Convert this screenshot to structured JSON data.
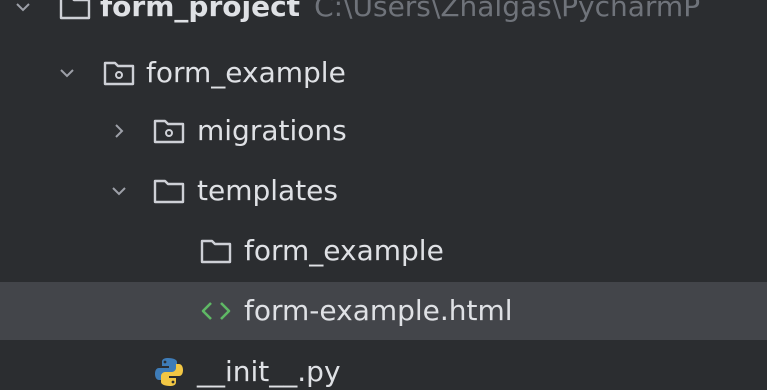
{
  "project_tree": {
    "root": {
      "name": "form_project",
      "path": "C:\\Users\\Zhalgas\\PycharmP"
    },
    "items": [
      {
        "label": "form_example"
      },
      {
        "label": "migrations"
      },
      {
        "label": "templates"
      },
      {
        "label": "form_example"
      },
      {
        "label": "form-example.html"
      },
      {
        "label": "__init__.py"
      }
    ]
  },
  "colors": {
    "background": "#2b2d30",
    "selection": "#43454a",
    "text": "#dfe1e5",
    "muted": "#6f737a",
    "html_icon": "#5fb865",
    "python_blue": "#3e7cb8",
    "python_yellow": "#f2c744"
  }
}
